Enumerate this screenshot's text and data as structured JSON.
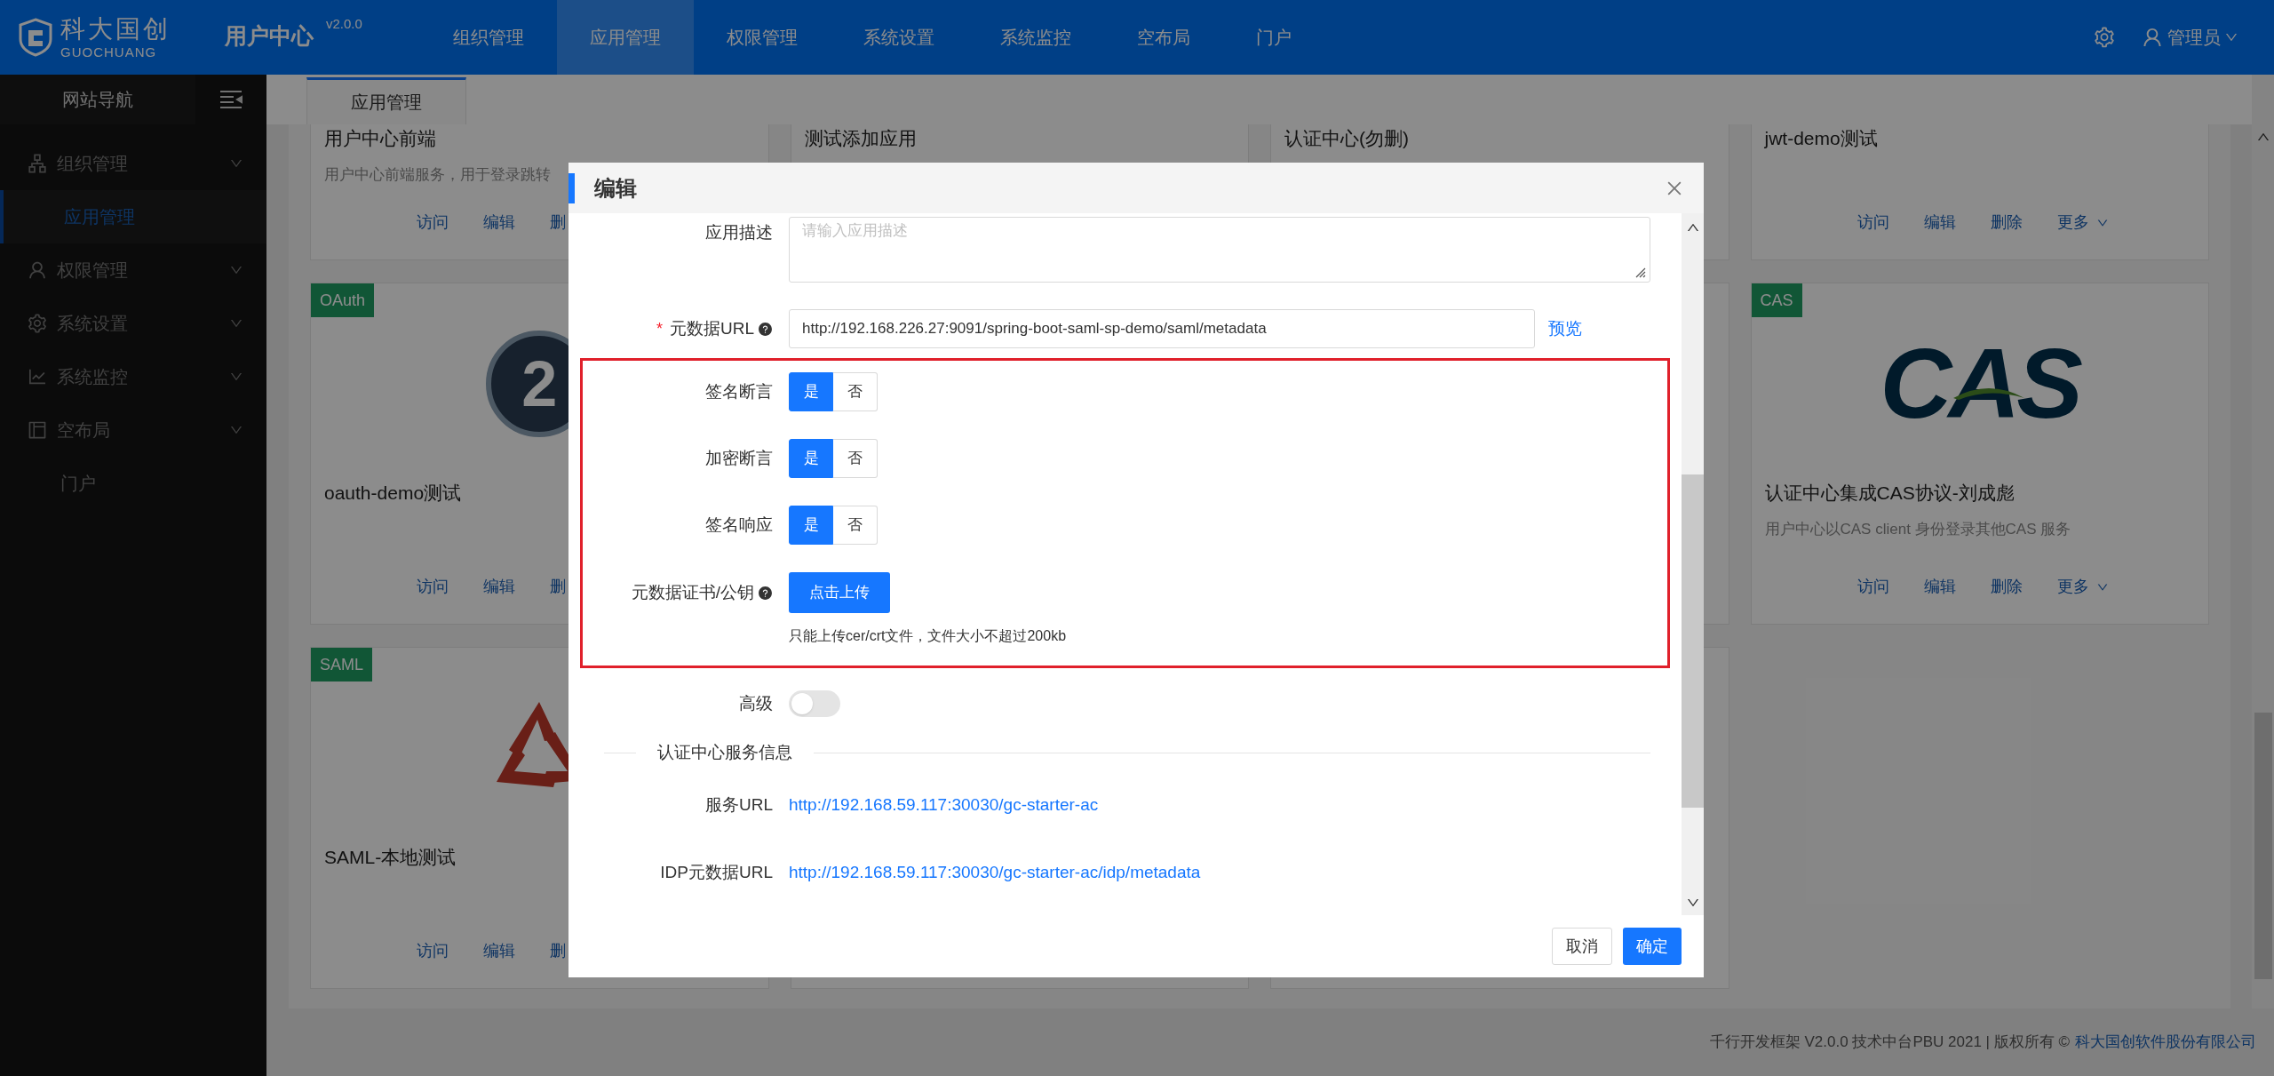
{
  "header": {
    "logo_text": "科大国创",
    "logo_subtext": "GUOCHUANG",
    "app_name": "用户中心",
    "version": "v2.0.0",
    "nav": [
      {
        "label": "组织管理",
        "selected": false
      },
      {
        "label": "应用管理",
        "selected": true
      },
      {
        "label": "权限管理",
        "selected": false
      },
      {
        "label": "系统设置",
        "selected": false
      },
      {
        "label": "系统监控",
        "selected": false
      },
      {
        "label": "空布局",
        "selected": false
      },
      {
        "label": "门户",
        "selected": false
      }
    ],
    "user": "管理员"
  },
  "sidebar": {
    "title": "网站导航",
    "items": [
      {
        "label": "组织管理",
        "kind": "group",
        "children": [
          {
            "label": "应用管理",
            "selected": true
          }
        ]
      },
      {
        "label": "权限管理",
        "kind": "group"
      },
      {
        "label": "系统设置",
        "kind": "group"
      },
      {
        "label": "系统监控",
        "kind": "group"
      },
      {
        "label": "空布局",
        "kind": "group"
      },
      {
        "label": "门户",
        "kind": "link"
      }
    ]
  },
  "tabs": [
    {
      "label": "应用管理",
      "selected": true
    }
  ],
  "card_rows": [
    [
      {
        "title": "用户中心前端",
        "description": "用户中心前端服务，用于登录跳转",
        "actions": [
          "访问",
          "编辑",
          "删"
        ]
      },
      {
        "title": "测试添加应用"
      },
      {
        "title": "认证中心(勿删)"
      },
      {
        "title": "jwt-demo测试",
        "actions": [
          "访问",
          "编辑",
          "删除"
        ],
        "more": "更多"
      }
    ],
    [
      {
        "kind": "oauth",
        "tag": "OAuth",
        "logo_text": "2",
        "title": "oauth-demo测试",
        "actions": [
          "访问",
          "编辑",
          "删"
        ]
      },
      {
        "kind": "cas",
        "tag": "CAS",
        "logo_text": "CAS",
        "title": "认证中心集成CAS协议-刘成彪",
        "description": "用户中心以CAS client 身份登录其他CAS 服务",
        "actions": [
          "访问",
          "编辑",
          "删除"
        ],
        "more": "更多"
      }
    ],
    [
      {
        "kind": "saml",
        "tag": "SAML",
        "title": "SAML-本地测试",
        "actions": [
          "访问",
          "编辑",
          "删"
        ]
      }
    ]
  ],
  "modal": {
    "title": "编辑",
    "fields": [
      {
        "kind": "textarea",
        "label": "应用描述",
        "placeholder": "请输入应用描述"
      },
      {
        "kind": "input",
        "label": "元数据URL",
        "required_mark": "*",
        "help": true,
        "value": "http://192.168.226.27:9091/spring-boot-saml-sp-demo/saml/metadata",
        "action": "预览"
      }
    ],
    "highlighted_fields": [
      {
        "kind": "choice",
        "label": "签名断言",
        "options": [
          {
            "label": "是",
            "selected": true
          },
          {
            "label": "否",
            "selected": false
          }
        ]
      },
      {
        "kind": "choice",
        "label": "加密断言",
        "options": [
          {
            "label": "是",
            "selected": true
          },
          {
            "label": "否",
            "selected": false
          }
        ]
      },
      {
        "kind": "choice",
        "label": "签名响应",
        "options": [
          {
            "label": "是",
            "selected": true
          },
          {
            "label": "否",
            "selected": false
          }
        ]
      },
      {
        "kind": "upload",
        "label": "元数据证书/公钥",
        "help": true,
        "button": "点击上传",
        "hint": "只能上传cer/crt文件，文件大小不超过200kb"
      }
    ],
    "advanced": {
      "label": "高级",
      "on": false
    },
    "section": "认证中心服务信息",
    "info": [
      {
        "label": "服务URL",
        "link": "http://192.168.59.117:30030/gc-starter-ac"
      },
      {
        "label": "IDP元数据URL",
        "link": "http://192.168.59.117:30030/gc-starter-ac/idp/metadata"
      }
    ],
    "buttons": [
      {
        "label": "取消",
        "kind": "default"
      },
      {
        "label": "确定",
        "kind": "primary"
      }
    ]
  },
  "footer": {
    "text": "千行开发框架 V2.0.0 技术中台PBU 2021 | 版权所有 ©",
    "link": "科大国创软件股份有限公司"
  }
}
